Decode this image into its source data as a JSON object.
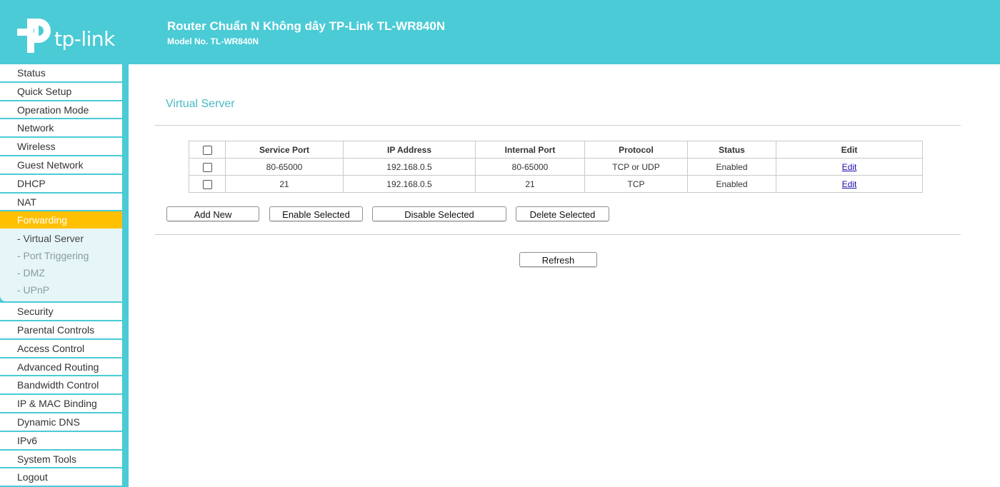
{
  "header": {
    "logo_text": "tp-link",
    "title": "Router Chuẩn N Không dây TP-Link TL-WR840N",
    "model": "Model No. TL-WR840N"
  },
  "colors": {
    "brand": "#4acbd6",
    "active_menu": "#ffc000",
    "title_text": "#4ab8c6"
  },
  "menu": {
    "before": [
      "Status",
      "Quick Setup",
      "Operation Mode",
      "Network",
      "Wireless",
      "Guest Network",
      "DHCP",
      "NAT"
    ],
    "active": "Forwarding",
    "submenu": [
      "- Virtual Server",
      "- Port Triggering",
      "- DMZ",
      "- UPnP"
    ],
    "after": [
      "Security",
      "Parental Controls",
      "Access Control",
      "Advanced Routing",
      "Bandwidth Control",
      "IP & MAC Binding",
      "Dynamic DNS",
      "IPv6",
      "System Tools",
      "Logout"
    ]
  },
  "page": {
    "title": "Virtual Server"
  },
  "table": {
    "headers": [
      "Service Port",
      "IP Address",
      "Internal Port",
      "Protocol",
      "Status",
      "Edit"
    ],
    "rows": [
      {
        "service_port": "80-65000",
        "ip": "192.168.0.5",
        "internal_port": "80-65000",
        "protocol": "TCP or UDP",
        "status": "Enabled",
        "edit": "Edit"
      },
      {
        "service_port": "21",
        "ip": "192.168.0.5",
        "internal_port": "21",
        "protocol": "TCP",
        "status": "Enabled",
        "edit": "Edit"
      }
    ]
  },
  "buttons": {
    "add_new": "Add New",
    "enable_selected": "Enable Selected",
    "disable_selected": "Disable Selected",
    "delete_selected": "Delete Selected",
    "refresh": "Refresh"
  }
}
